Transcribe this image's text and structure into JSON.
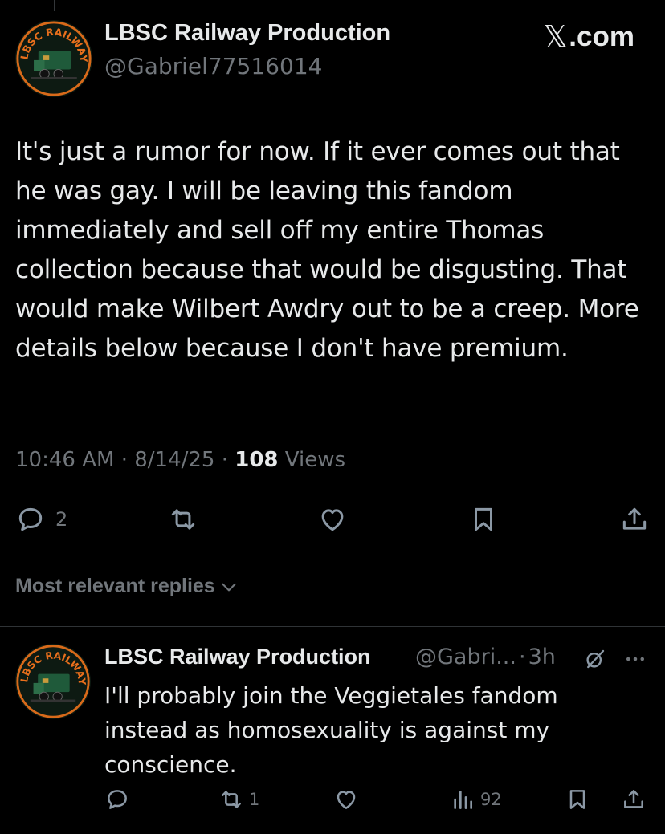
{
  "main_tweet": {
    "author_name": "LBSC Railway Production",
    "handle": "@Gabriel77516014",
    "avatar_text": "LBSC RAILWAY PRODUCTION",
    "text": "It's just a rumor for now. If it ever comes out that he was gay. I will be leaving this fandom immediately and sell off my entire Thomas collection because that would be disgusting. That would make Wilbert Awdry out to be a creep. More details below because I don't have premium.",
    "time": "10:46 AM",
    "date": "8/14/25",
    "sep": "·",
    "views_count": "108",
    "views_label": "Views",
    "reply_count": "2"
  },
  "watermark": {
    "x_glyph": "𝕏",
    "label": ".com"
  },
  "replies_toggle": {
    "label": "Most relevant replies"
  },
  "reply": {
    "author_name": "LBSC Railway Production",
    "handle": "@Gabri...",
    "sep": "·",
    "age": "3h",
    "text": "I'll probably join the Veggietales fandom instead as homosexuality is against my conscience.",
    "retweet_count": "1",
    "views_count": "92"
  },
  "colors": {
    "background": "#000000",
    "text": "#e7e9ea",
    "muted": "#71767b",
    "divider": "#2f3336"
  },
  "icons": [
    "reply-icon",
    "retweet-icon",
    "like-icon",
    "bookmark-icon",
    "share-icon",
    "views-icon",
    "grok-icon",
    "more-icon",
    "chevron-down-icon"
  ]
}
